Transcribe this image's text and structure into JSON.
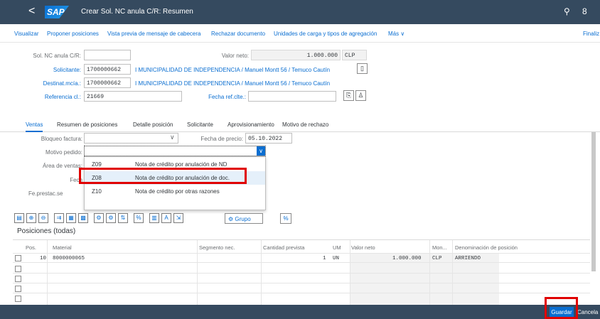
{
  "shell": {
    "back": "<",
    "logo": "SAP",
    "title": "Crear Sol. NC anula C/R: Resumen",
    "search_icon": "⚲",
    "user_icon": "8"
  },
  "toolbar": {
    "items": [
      "Visualizar",
      "Proponer posiciones",
      "Vista previa de mensaje de cabecera",
      "Rechazar documento",
      "Unidades de carga y tipos de agregación",
      "Más ∨",
      "Finaliz"
    ]
  },
  "header": {
    "sol_label": "Sol. NC anula C/R:",
    "sol_value": "",
    "valor_neto_label": "Valor neto:",
    "valor_neto_value": "1.000.000",
    "currency": "CLP",
    "solicitante_label": "Solicitante:",
    "solicitante_value": "1700000662",
    "solicitante_text": "I MUNICIPALIDAD DE INDEPENDENCIA / Manuel Montt 56 / Temuco Cautín",
    "destinat_label": "Destinat.mcía.:",
    "destinat_value": "1700000662",
    "destinat_text": "I MUNICIPALIDAD DE INDEPENDENCIA / Manuel Montt 56 / Temuco Cautín",
    "referencia_label": "Referencia cl.:",
    "referencia_value": "21669",
    "fecha_ref_label": "Fecha ref.clte.:",
    "fecha_ref_value": ""
  },
  "tabs": [
    "Ventas",
    "Resumen de posiciones",
    "Detalle posición",
    "Solicitante",
    "Aprovisionamiento",
    "Motivo de rechazo"
  ],
  "ventas": {
    "bloqueo_label": "Bloqueo factura:",
    "bloqueo_value": "",
    "fecha_precio_label": "Fecha de precio:",
    "fecha_precio_value": "05.10.2022",
    "motivo_label": "Motivo pedido:",
    "motivo_value": "",
    "area_label": "Área de ventas:",
    "fech_label": "Fech",
    "fe_prestac_label": "Fe.prestac.se"
  },
  "dropdown": {
    "options": [
      {
        "code": "Z09",
        "desc": "Nota de crédito por anulación de ND"
      },
      {
        "code": "Z08",
        "desc": "Nota de crédito por anulación de doc."
      },
      {
        "code": "Z10",
        "desc": "Nota de crédito por otras razones"
      }
    ]
  },
  "grid_toolbar": {
    "grupo_label": "Grupo"
  },
  "positions": {
    "title": "Posiciones (todas)",
    "columns": [
      "Pos.",
      "Material",
      "Segmento nec.",
      "Cantidad prevista",
      "UM",
      "Valor neto",
      "Mon...",
      "Denominación de posición"
    ],
    "rows": [
      {
        "pos": "10",
        "material": "8000000065",
        "segmento": "",
        "cantidad": "1",
        "um": "UN",
        "valor": "1.000.000",
        "mon": "CLP",
        "denominacion": "ARRIENDO"
      }
    ]
  },
  "footer": {
    "save_label": "Guardar",
    "cancel_label": "Cancela"
  },
  "colors": {
    "shell": "#354a5f",
    "accent": "#0a6ed1",
    "highlight": "#e00000"
  }
}
